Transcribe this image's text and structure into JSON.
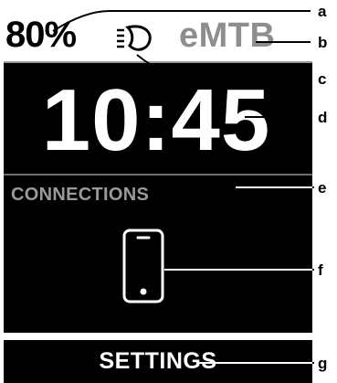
{
  "display": {
    "battery_level": "80%",
    "ride_mode": "eMTB",
    "time": "10:45",
    "section_title": "CONNECTIONS",
    "settings_label": "SETTINGS"
  },
  "icons": {
    "headlight": "headlight-icon",
    "phone": "smartphone-icon"
  },
  "callouts": {
    "a": "a",
    "b": "b",
    "c": "c",
    "d": "d",
    "e": "e",
    "f": "f",
    "g": "g"
  },
  "colors": {
    "screen_background": "#000000",
    "primary_text": "#ffffff",
    "muted_text": "#8e8e8e"
  }
}
